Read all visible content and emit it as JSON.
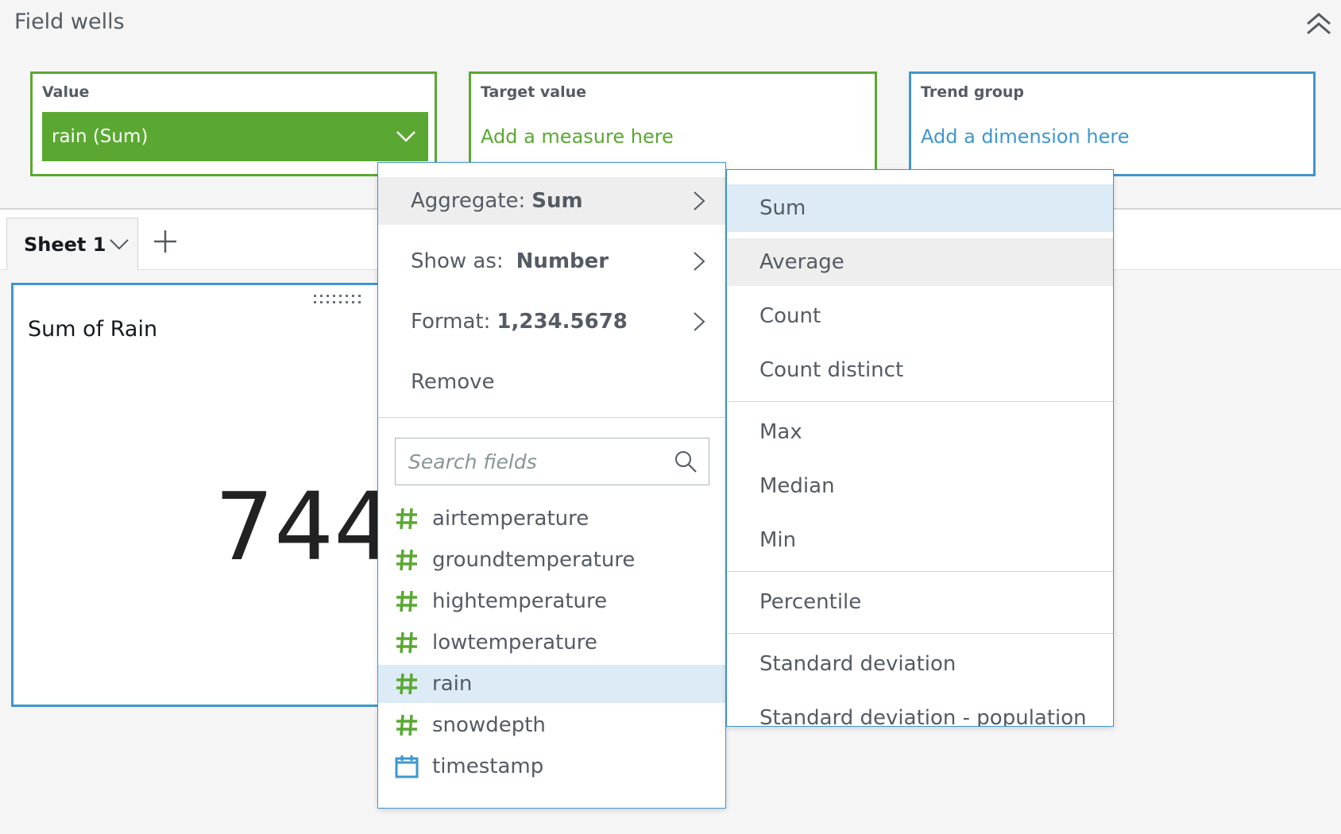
{
  "field_wells": {
    "title": "Field wells",
    "value": {
      "label": "Value",
      "field": "rain (Sum)"
    },
    "target": {
      "label": "Target value",
      "placeholder": "Add a measure here"
    },
    "trend": {
      "label": "Trend group",
      "placeholder": "Add a dimension here"
    }
  },
  "tabs": {
    "sheet": "Sheet 1"
  },
  "visual": {
    "title": "Sum of Rain",
    "kpi": "744"
  },
  "menu": {
    "aggregate": {
      "prefix": "Aggregate:",
      "value": "Sum"
    },
    "show_as": {
      "prefix": "Show as:",
      "value": "Number"
    },
    "format": {
      "prefix": "Format:",
      "value": "1,234.5678"
    },
    "remove": "Remove",
    "search_placeholder": "Search fields",
    "fields": [
      {
        "name": "airtemperature",
        "icon": "hash-icon"
      },
      {
        "name": "groundtemperature",
        "icon": "hash-icon"
      },
      {
        "name": "hightemperature",
        "icon": "hash-icon"
      },
      {
        "name": "lowtemperature",
        "icon": "hash-icon"
      },
      {
        "name": "rain",
        "icon": "hash-icon"
      },
      {
        "name": "snowdepth",
        "icon": "hash-icon"
      },
      {
        "name": "timestamp",
        "icon": "calendar-icon"
      }
    ]
  },
  "aggregate_options": [
    "Sum",
    "Average",
    "Count",
    "Count distinct",
    "Max",
    "Median",
    "Min",
    "Percentile",
    "Standard deviation",
    "Standard deviation - population"
  ],
  "colors": {
    "measure_green": "#5aa832",
    "dimension_blue": "#3e96cf",
    "selected_bg": "#dcebf6",
    "hover_bg": "#eeeeee"
  }
}
